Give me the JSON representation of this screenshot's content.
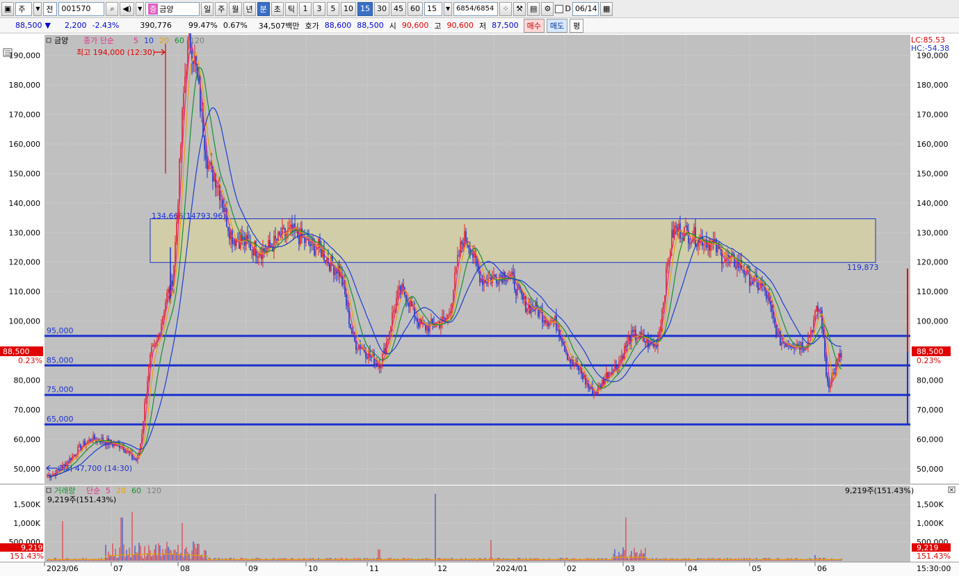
{
  "toolbar": {
    "market_type": "주",
    "exchange": "전",
    "stock_code": "001570",
    "stock_badge": "증",
    "stock_name": "금양",
    "period_day": "일",
    "period_week": "주",
    "period_month": "월",
    "period_year": "년",
    "period_minute": "분",
    "period_second": "초",
    "period_tick": "틱",
    "intervals": [
      "1",
      "3",
      "5",
      "10",
      "15",
      "30",
      "45",
      "60"
    ],
    "selected_interval": "15",
    "interval_value": "15",
    "count_text": "6854",
    "count_total": "/6854",
    "checkbox_label": "D",
    "date_value": "06/14"
  },
  "quote": {
    "price": "88,500",
    "direction_icon": "▼",
    "change": "2,200",
    "change_pct": "-2.43%",
    "volume": "390,776",
    "volume_ratio": "99.47%",
    "turnover_pct": "0.67%",
    "trade_value": "34,507백만",
    "ask_label": "호가",
    "ask1": "88,600",
    "ask2": "88,500",
    "open_label": "시",
    "open": "90,600",
    "high_label": "고",
    "high": "90,600",
    "low_label": "저",
    "low": "87,500",
    "buy_button": "매수",
    "sell_button": "매도",
    "eval_button": "평"
  },
  "price_pane": {
    "legend_name": "금양",
    "legend_ma": "종가 단순",
    "ma_periods": [
      "5",
      "10",
      "20",
      "60",
      "120"
    ],
    "ma_colors": [
      "#e0308c",
      "#1a3cd0",
      "#e8a000",
      "#14902c",
      "#808080"
    ],
    "lc_label": "LC:85.53",
    "hc_label": "HC:-54.38",
    "max_annotation": "최고 194,000 (12:30)",
    "min_annotation": "최저 47,700 (14:30)",
    "box_label_top": "134,666(14793.96)",
    "box_label_bottom": "119,873",
    "current_price_tag": "88,500",
    "current_pct_tag": "0.23%",
    "horizontal_levels": [
      "95,000",
      "85,000",
      "75,000",
      "65,000"
    ],
    "y_ticks": [
      "190,000",
      "180,000",
      "170,000",
      "160,000",
      "150,000",
      "140,000",
      "130,000",
      "120,000",
      "110,000",
      "100,000",
      "90,000",
      "80,000",
      "70,000",
      "60,000",
      "50,000"
    ]
  },
  "volume_pane": {
    "legend_name": "거래량",
    "legend_ma": "단순",
    "ma_periods": [
      "5",
      "20",
      "60",
      "120"
    ],
    "current_label": "9,219주(151.43%)",
    "right_label": "9,219주(151.43%)",
    "tag_value": "9,219",
    "tag_pct": "151.43%",
    "y_ticks": [
      "1,500K",
      "1,000K",
      "500,000"
    ]
  },
  "x_axis": {
    "labels": [
      "2023/06",
      "07",
      "08",
      "09",
      "10",
      "11",
      "12",
      "2024/01",
      "02",
      "03",
      "04",
      "05",
      "06"
    ],
    "time_label": "15:30:00"
  },
  "chart_data": {
    "type": "line",
    "title": "",
    "xlabel": "",
    "ylabel": "",
    "ylim": [
      45000,
      197000
    ],
    "x": [
      "2023/06",
      "2023/06",
      "2023/07",
      "2023/07",
      "2023/07",
      "2023/07",
      "2023/08",
      "2023/08",
      "2023/08",
      "2023/09",
      "2023/09",
      "2023/10",
      "2023/10",
      "2023/10",
      "2023/11",
      "2023/11",
      "2023/11",
      "2023/12",
      "2023/12",
      "2023/12",
      "2024/01",
      "2024/01",
      "2024/01",
      "2024/02",
      "2024/02",
      "2024/02",
      "2024/03",
      "2024/03",
      "2024/03",
      "2024/04",
      "2024/04",
      "2024/05",
      "2024/05",
      "2024/05",
      "2024/06",
      "2024/06",
      "2024/06"
    ],
    "series": [
      {
        "values": [
          47700,
          60000,
          58000,
          53000,
          90000,
          110000,
          194000,
          150000,
          128000,
          124000,
          130000,
          125000,
          118000,
          92000,
          86000,
          110000,
          98000,
          100000,
          128000,
          114000,
          116000,
          105000,
          100000,
          85000,
          76000,
          84000,
          95000,
          92000,
          131000,
          128000,
          120000,
          112000,
          93000,
          92000,
          104000,
          79000,
          88500
        ]
      }
    ],
    "box": {
      "top": 134666,
      "bottom": 119873
    },
    "levels": [
      95000,
      85000,
      75000,
      65000
    ],
    "volume_ylim": [
      0,
      2000000
    ],
    "volume_peaks": [
      {
        "x": "2023/06",
        "value": 1050000
      },
      {
        "x": "2023/07",
        "value": 1150000
      },
      {
        "x": "2023/07",
        "value": 1300000
      },
      {
        "x": "2023/08",
        "value": 1000000
      },
      {
        "x": "2023/11",
        "value": 300000
      },
      {
        "x": "2023/12",
        "value": 1780000
      },
      {
        "x": "2024/01",
        "value": 550000
      },
      {
        "x": "2024/03",
        "value": 1150000
      },
      {
        "x": "2024/06",
        "value": 150000
      }
    ]
  }
}
